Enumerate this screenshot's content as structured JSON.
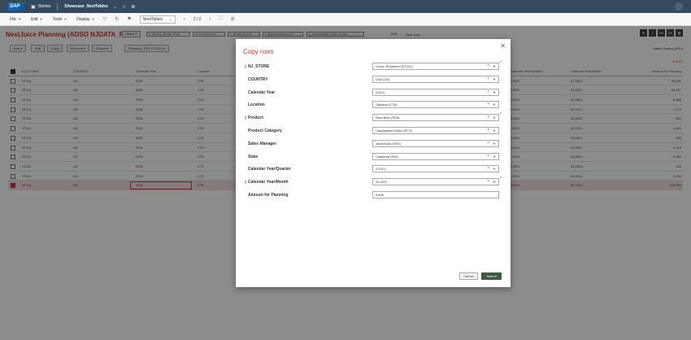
{
  "shell": {
    "product": "SAP",
    "stories_label": "Stories",
    "story_title": "Showcase_NextTables"
  },
  "toolbar": {
    "menus": [
      "File",
      "Edit",
      "Tools",
      "Display"
    ],
    "page_select": "NextTables",
    "page_indicator": "2 / 2"
  },
  "header": {
    "title": "NextJuice Planning (ADSO NJDATA_P)",
    "filters_label": "Filters",
    "filter_chips": [
      "C_BICVALL_STORE: ST111",
      "C_CALYEAR: 2021",
      "C_BIC/NJLOC: CT6",
      "C_BIC/NJPRODCAT: PC1",
      "C_CALQUARTER: 1.2021 - 4.2021"
    ],
    "max_count": "1000",
    "max_label": "Max rows",
    "right_buttons": [
      "EN",
      "DE"
    ],
    "user_name": "Rafael Santos (RS0)"
  },
  "actions": {
    "add": "Add",
    "edit": "Edit",
    "copy": "Copy",
    "remove": "Remove",
    "export": "Export",
    "planning": "Planning - PC1 / ST111"
  },
  "pager": "1 of 12",
  "grid": {
    "columns": [
      "NJ_STORE",
      "COUNTRY",
      "Calendar Year",
      "Location",
      "Calendar Year/Quarter",
      "Calendar Year/Month",
      "Amount for Planning"
    ],
    "rows": [
      {
        "store": "ST111",
        "country": "US",
        "year": "2021",
        "loc": "CT6",
        "quarter": "1.2021",
        "month": "01.2021",
        "amount": "20.000"
      },
      {
        "store": "ST111",
        "country": "US",
        "year": "2021",
        "loc": "CT6",
        "quarter": "1.2021",
        "month": "01.2021",
        "amount": "25.127"
      },
      {
        "store": "ST111",
        "country": "US",
        "year": "2021",
        "loc": "CT6",
        "quarter": "1.2021",
        "month": "02.2021",
        "amount": "6.668"
      },
      {
        "store": "ST111",
        "country": "US",
        "year": "2021",
        "loc": "CT6",
        "quarter": "1.2021",
        "month": "02.2021",
        "amount": "7.174"
      },
      {
        "store": "ST111",
        "country": "US",
        "year": "2021",
        "loc": "CT6",
        "quarter": "1.2021",
        "month": "02.2021",
        "amount": "664"
      },
      {
        "store": "ST111",
        "country": "US",
        "year": "2021",
        "loc": "CT6",
        "quarter": "1.2021",
        "month": "02.2021",
        "amount": "1.840"
      },
      {
        "store": "ST111",
        "country": "US",
        "year": "2021",
        "loc": "CT6",
        "quarter": "1.2021",
        "month": "03.2021",
        "amount": "520"
      },
      {
        "store": "ST111",
        "country": "US",
        "year": "2021",
        "loc": "CT6",
        "quarter": "1.2021",
        "month": "03.2021",
        "amount": "2.019"
      },
      {
        "store": "ST111",
        "country": "US",
        "year": "2021",
        "loc": "CT6",
        "quarter": "2.2021",
        "month": "04.2021",
        "amount": "9.050"
      },
      {
        "store": "ST111",
        "country": "US",
        "year": "2021",
        "loc": "CT6",
        "quarter": "2.2021",
        "month": "04.2021",
        "amount": "333"
      },
      {
        "store": "ST111",
        "country": "US",
        "year": "2021",
        "loc": "CT6",
        "quarter": "2.2021",
        "month": "04.2021",
        "amount": "2.099"
      },
      {
        "store": "ST111",
        "country": "US",
        "year": "2021",
        "loc": "CT6",
        "quarter": "2.2021",
        "month": "04.2021",
        "amount": "110.000"
      }
    ]
  },
  "dialog": {
    "title": "Copy rows",
    "fields": [
      {
        "label": "NJ_STORE",
        "value": "Crown Showered (ST111)",
        "key": true,
        "required": true
      },
      {
        "label": "COUNTRY",
        "value": "USA (US)",
        "key": false,
        "required": false
      },
      {
        "label": "Calendar Year",
        "value": "(2021)",
        "key": false,
        "required": false
      },
      {
        "label": "Location",
        "value": "Oakland (CT6)",
        "key": false,
        "required": false
      },
      {
        "label": "Product",
        "value": "Root Beer (PD8)",
        "key": true,
        "required": true
      },
      {
        "label": "Product Category",
        "value": "Carbonated Drinks (PC1)",
        "key": false,
        "required": false
      },
      {
        "label": "Sales Manager",
        "value": "Janet Bury (SM1)",
        "key": false,
        "required": false
      },
      {
        "label": "State",
        "value": "California (SA1)",
        "key": false,
        "required": false
      },
      {
        "label": "Calendar Year/Quarter",
        "value": "2.2021",
        "key": false,
        "required": false
      },
      {
        "label": "Calendar Year/Month",
        "value": "05.2021",
        "key": true,
        "required": true
      },
      {
        "label": "Amount for Planning",
        "value": "5.600",
        "key": false,
        "required": false
      }
    ],
    "cancel": "Cancel",
    "submit": "Submit"
  }
}
